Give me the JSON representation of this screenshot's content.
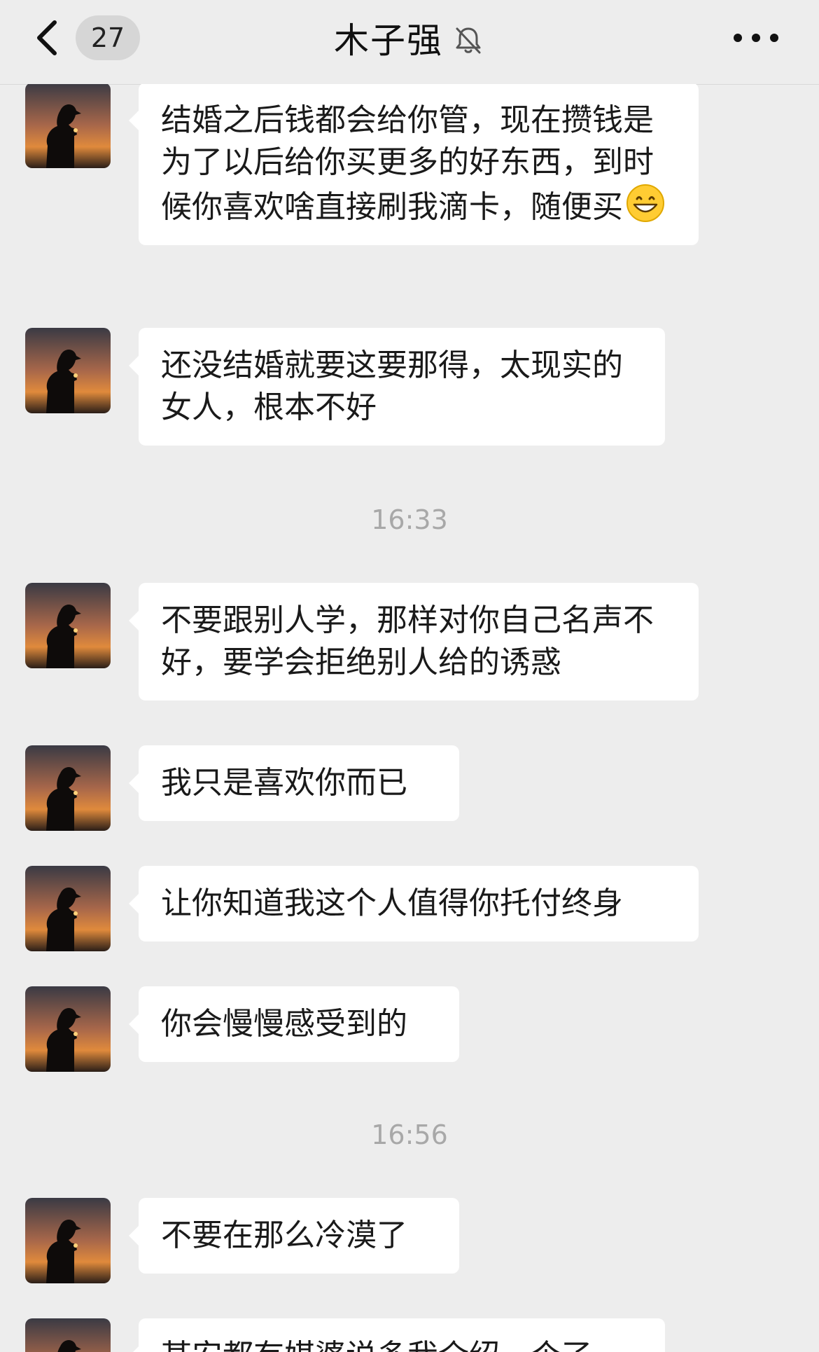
{
  "header": {
    "back_icon": "chevron-left-icon",
    "unread_count": "27",
    "title": "木子强",
    "mute_icon": "bell-muted-icon",
    "more_icon": "ellipsis-icon"
  },
  "messages": [
    {
      "text": "结婚之后钱都会给你管，现在攒钱是为了以后给你买更多的好东西，到时候你喜欢啥直接刷我滴卡，随便买",
      "emoji": "grinning-face"
    },
    {
      "text": "还没结婚就要这要那得，太现实的女人，根本不好"
    },
    {
      "timestamp": "16:33"
    },
    {
      "text": "不要跟别人学，那样对你自己名声不好，要学会拒绝别人给的诱惑"
    },
    {
      "text": "我只是喜欢你而已"
    },
    {
      "text": "让你知道我这个人值得你托付终身"
    },
    {
      "text": "你会慢慢感受到的"
    },
    {
      "timestamp": "16:56"
    },
    {
      "text": "不要在那么冷漠了"
    },
    {
      "text": "某安都有媒婆说多我介绍一个了"
    }
  ],
  "colors": {
    "background": "#EDEDED",
    "bubble": "#FFFFFF",
    "timestamp": "#A8A8A8",
    "text": "#1A1A1A"
  }
}
